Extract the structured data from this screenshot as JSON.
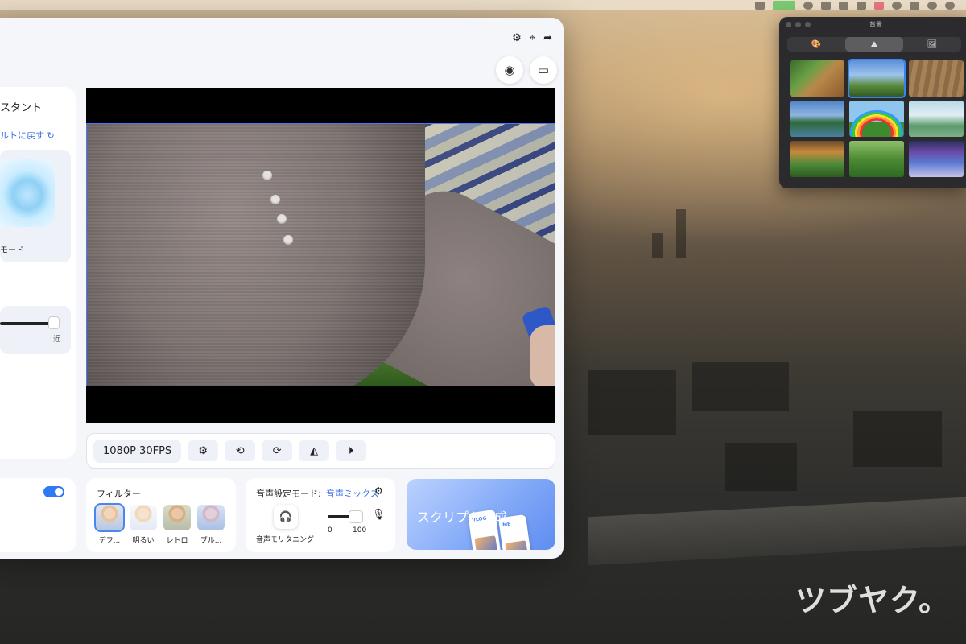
{
  "colors": {
    "accent": "#2f7af0",
    "link": "#3c6ee0",
    "selection": "#3b82f6"
  },
  "menubar": {
    "icons": [
      "app-icon",
      "sketch-icon",
      "cloud-icon",
      "cursor-icon",
      "shield-icon",
      "dropbox-icon",
      "mail-icon",
      "grammar-icon",
      "note-icon",
      "play-icon",
      "headphones-icon"
    ]
  },
  "app": {
    "top_actions": {
      "settings_icon": "⚙",
      "pin_icon": "⌖",
      "share_icon": "➦"
    },
    "round_buttons": {
      "webcam_icon": "◉",
      "screen_icon": "▭"
    },
    "assistant": {
      "title": "スタント",
      "reset_label": "ルトに戻す ↻",
      "mode_label": "モード",
      "slider_near_label": "近"
    },
    "controls": {
      "resolution": "1080P 30FPS",
      "settings_icon": "⚙",
      "rotate_left_icon": "⟲",
      "rotate_right_icon": "⟳",
      "flip_h_icon": "◭",
      "flip_v_icon": "⏵"
    },
    "filters": {
      "title": "フィルター",
      "items": [
        "デフ...",
        "明るい",
        "レトロ",
        "ブル..."
      ]
    },
    "audio": {
      "title": "音声設定モード:",
      "mode": "音声ミックス",
      "gear_icon": "⚙",
      "headphone_icon": "🎧",
      "monitor_label": "音声モリタニング",
      "mic_icon": "🎙",
      "min": "0",
      "max": "100"
    },
    "script": {
      "label": "スクリプト生成",
      "phone1": "VLOG",
      "phone2": "ME"
    }
  },
  "palette": {
    "title": "背景",
    "tabs": [
      "🎨",
      "⛰",
      "🖼"
    ]
  },
  "watermark": "ツブヤク。"
}
